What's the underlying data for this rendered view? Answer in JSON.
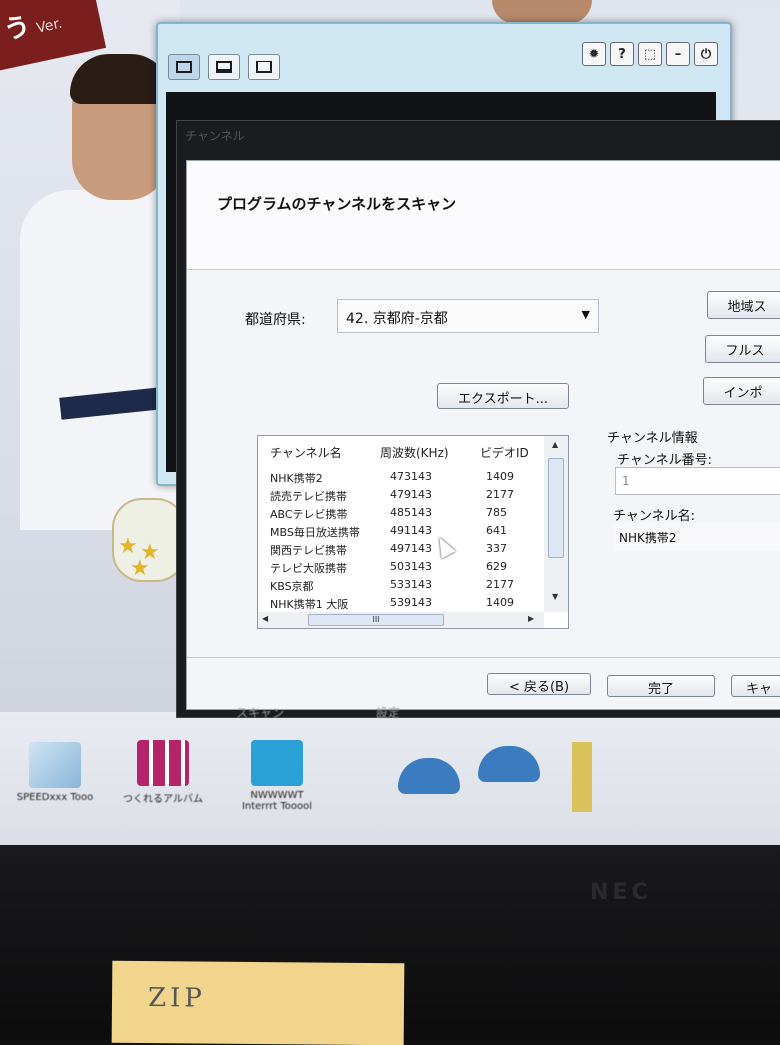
{
  "desktop": {
    "logo_text": "う",
    "logo_suffix": "Ver.",
    "icons": [
      {
        "label": "SPEEDxxx Tooo"
      },
      {
        "label": "つくれるアルバム"
      },
      {
        "label": "NWWWWT Interrrt Tooool"
      }
    ],
    "under_dialog_labels": [
      "スキャン",
      "設定"
    ]
  },
  "app_window": {
    "toolbar_icons": [
      "monitor-icon",
      "display-icon",
      "window-icon"
    ],
    "controls": {
      "settings": "✹",
      "help": "?",
      "restore": "⬚",
      "minimize": "–",
      "power": "⏻"
    }
  },
  "dialog": {
    "window_title": "チャンネル",
    "heading": "プログラムのチャンネルをスキャン",
    "prefecture_label": "都道府県:",
    "prefecture_value": "42. 京都府-京都",
    "buttons": {
      "region_scan": "地域ス",
      "full_scan": "フルス",
      "import": "インポ",
      "export": "エクスポート...",
      "back": "< 戻る(B)",
      "finish": "完了",
      "cancel": "キャ"
    },
    "table": {
      "headers": [
        "チャンネル名",
        "周波数(KHz)",
        "ビデオID"
      ],
      "rows": [
        {
          "name": "NHK携帯2",
          "freq": "473143",
          "vid": "1409"
        },
        {
          "name": "読売テレビ携帯",
          "freq": "479143",
          "vid": "2177"
        },
        {
          "name": "ABCテレビ携帯",
          "freq": "485143",
          "vid": "785"
        },
        {
          "name": "MBS毎日放送携帯",
          "freq": "491143",
          "vid": "641"
        },
        {
          "name": "関西テレビ携帯",
          "freq": "497143",
          "vid": "337"
        },
        {
          "name": "テレビ大阪携帯",
          "freq": "503143",
          "vid": "629"
        },
        {
          "name": "KBS京都",
          "freq": "533143",
          "vid": "2177"
        },
        {
          "name": "NHK携帯1 大阪",
          "freq": "539143",
          "vid": "1409"
        }
      ],
      "hscroll_thumb": "III"
    },
    "channel_info": {
      "title": "チャンネル情報",
      "number_label": "チャンネル番号:",
      "number_value": "1",
      "name_label": "チャンネル名:",
      "name_value": "NHK携帯2"
    }
  },
  "hardware": {
    "brand": "NEC",
    "note_text": "ZIP"
  }
}
